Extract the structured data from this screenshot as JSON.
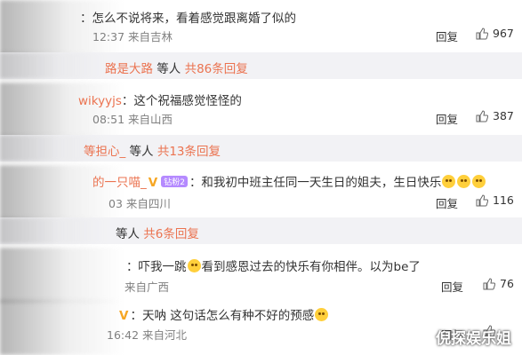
{
  "action_labels": {
    "reply": "回复"
  },
  "colors": {
    "accent": "#eb7350",
    "meta": "#808080",
    "bar_bg": "#f2f2f5"
  },
  "comments": [
    {
      "author": "",
      "text": "：怎么不说将来，看着感觉跟离婚了似的",
      "time": "12:37",
      "location": "来自吉林",
      "likes": "967"
    },
    {
      "author": "wikyyjs",
      "text": "：这个祝福感觉怪怪的",
      "time": "08:51",
      "location": "来自山西",
      "likes": "387"
    },
    {
      "author": "的一只喵_",
      "badge_tag": "钻粉2",
      "text": "：和我初中班主任同一天生日的姐夫，生日快乐",
      "time_prefix": "",
      "time": "03",
      "location": "来自四川",
      "likes": "116"
    },
    {
      "author": "",
      "text": "：吓我一跳",
      "text_after": "看到感恩过去的快乐有你相伴。以为be了",
      "time": "",
      "location": "来自广西",
      "likes": "76"
    },
    {
      "author": "",
      "text": "：天呐 这句话怎么有种不好的预感",
      "time": "16:42",
      "location": "来自河北",
      "likes": ""
    }
  ],
  "reply_bars": [
    {
      "prefix": "路是大路",
      "middle": " 等人 ",
      "link": "共86条回复"
    },
    {
      "prefix": "等担心_",
      "middle": " 等人 ",
      "link": "共13条回复"
    },
    {
      "prefix": "",
      "middle": "等人 ",
      "link": "共6条回复"
    }
  ],
  "watermark": "倪探娱乐姐"
}
